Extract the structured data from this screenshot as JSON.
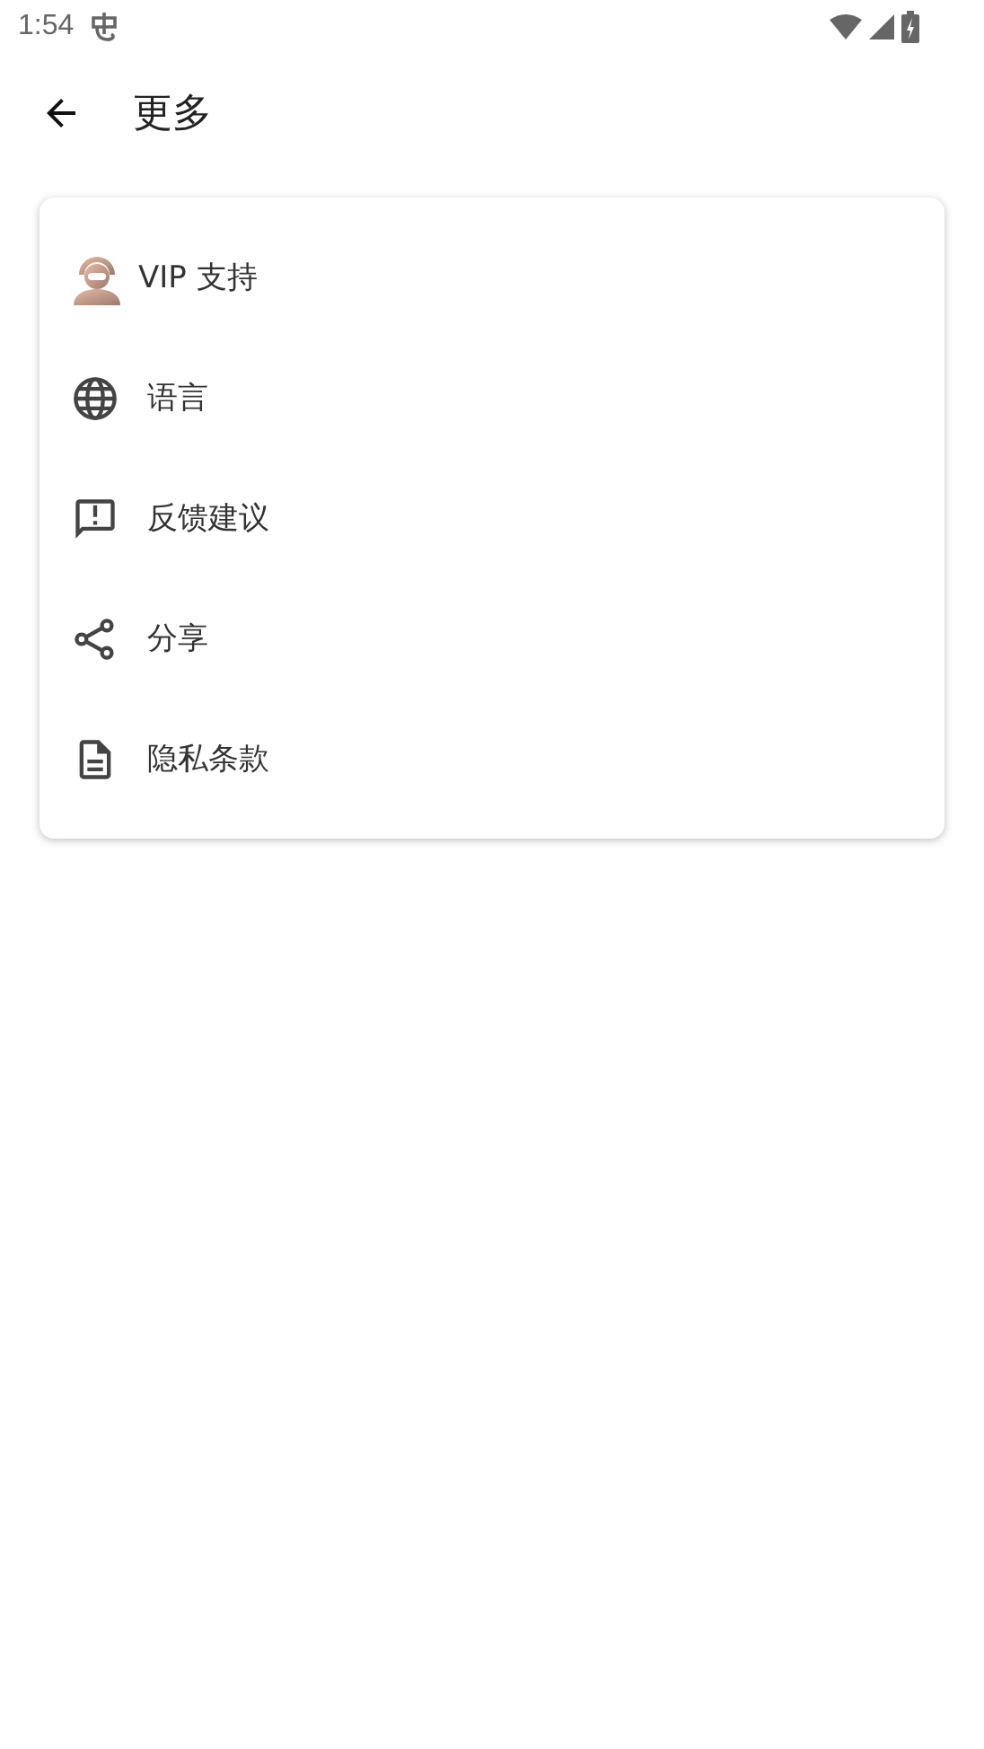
{
  "status_bar": {
    "time": "1:54"
  },
  "app_bar": {
    "title": "更多"
  },
  "menu": [
    {
      "kind": "agent",
      "label": "VIP 支持"
    },
    {
      "kind": "globe",
      "label": "语言"
    },
    {
      "kind": "feedback",
      "label": "反馈建议"
    },
    {
      "kind": "share",
      "label": "分享"
    },
    {
      "kind": "document",
      "label": "隐私条款"
    }
  ]
}
